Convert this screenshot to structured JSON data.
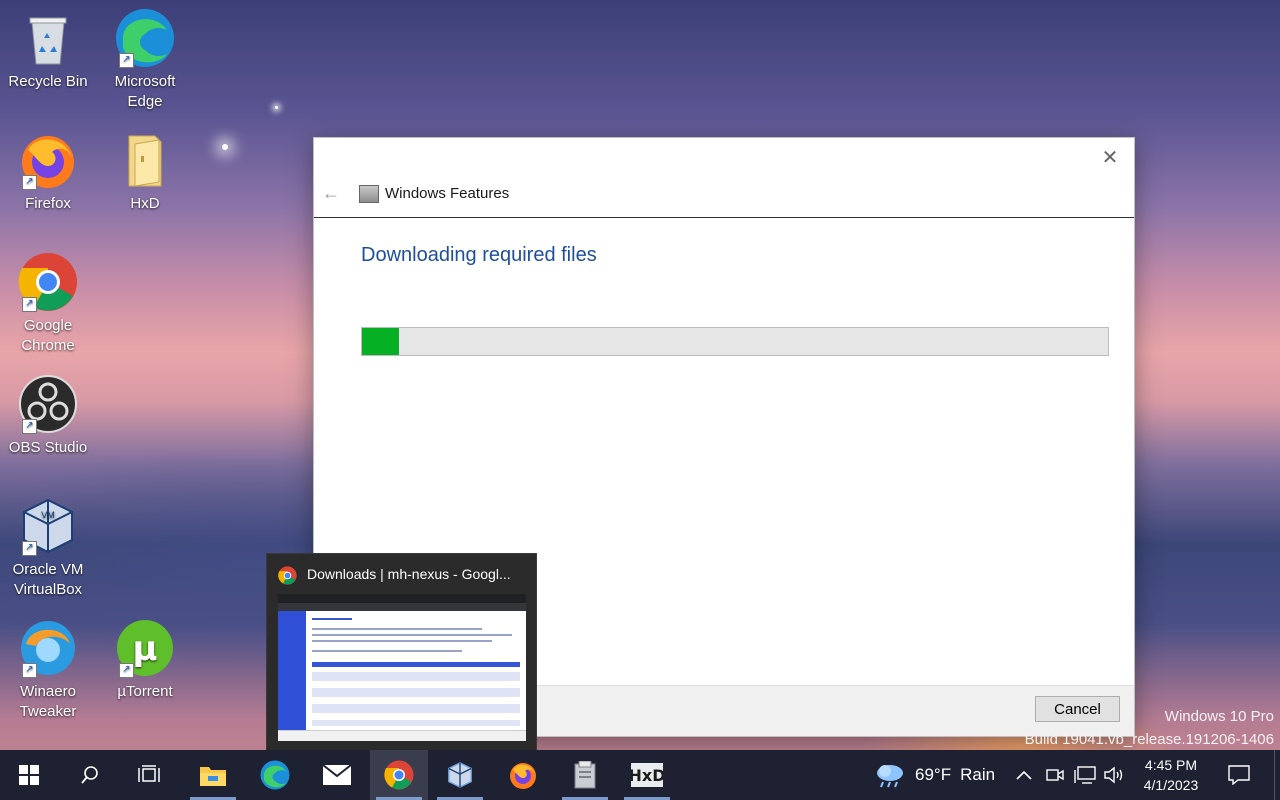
{
  "desktop": {
    "icons": [
      {
        "label": "Recycle Bin",
        "icon": "recycle-bin-icon"
      },
      {
        "label": "Microsoft Edge",
        "icon": "edge-icon"
      },
      {
        "label": "Firefox",
        "icon": "firefox-icon"
      },
      {
        "label": "HxD",
        "icon": "folder-icon"
      },
      {
        "label": "Google Chrome",
        "icon": "chrome-icon"
      },
      {
        "label": "OBS Studio",
        "icon": "obs-icon"
      },
      {
        "label": "Oracle VM VirtualBox",
        "icon": "virtualbox-icon"
      },
      {
        "label": "Winaero Tweaker",
        "icon": "winaero-icon"
      },
      {
        "label": "µTorrent",
        "icon": "utorrent-icon"
      }
    ],
    "watermark_line1": "Windows 10 Pro",
    "watermark_line2": "Build 19041.vb_release.191206-1406"
  },
  "dialog": {
    "title": "Windows Features",
    "heading": "Downloading required files",
    "progress_percent": 5,
    "cancel_label": "Cancel",
    "close_glyph": "✕",
    "back_glyph": "←"
  },
  "thumbnail": {
    "title": "Downloads | mh-nexus - Googl..."
  },
  "taskbar": {
    "weather_temp": "69°F",
    "weather_condition": "Rain",
    "time": "4:45 PM",
    "date": "4/1/2023"
  },
  "colors": {
    "accent_blue": "#1f4e9c",
    "progress_green": "#06b025",
    "taskbar_bg": "#1e2131"
  }
}
